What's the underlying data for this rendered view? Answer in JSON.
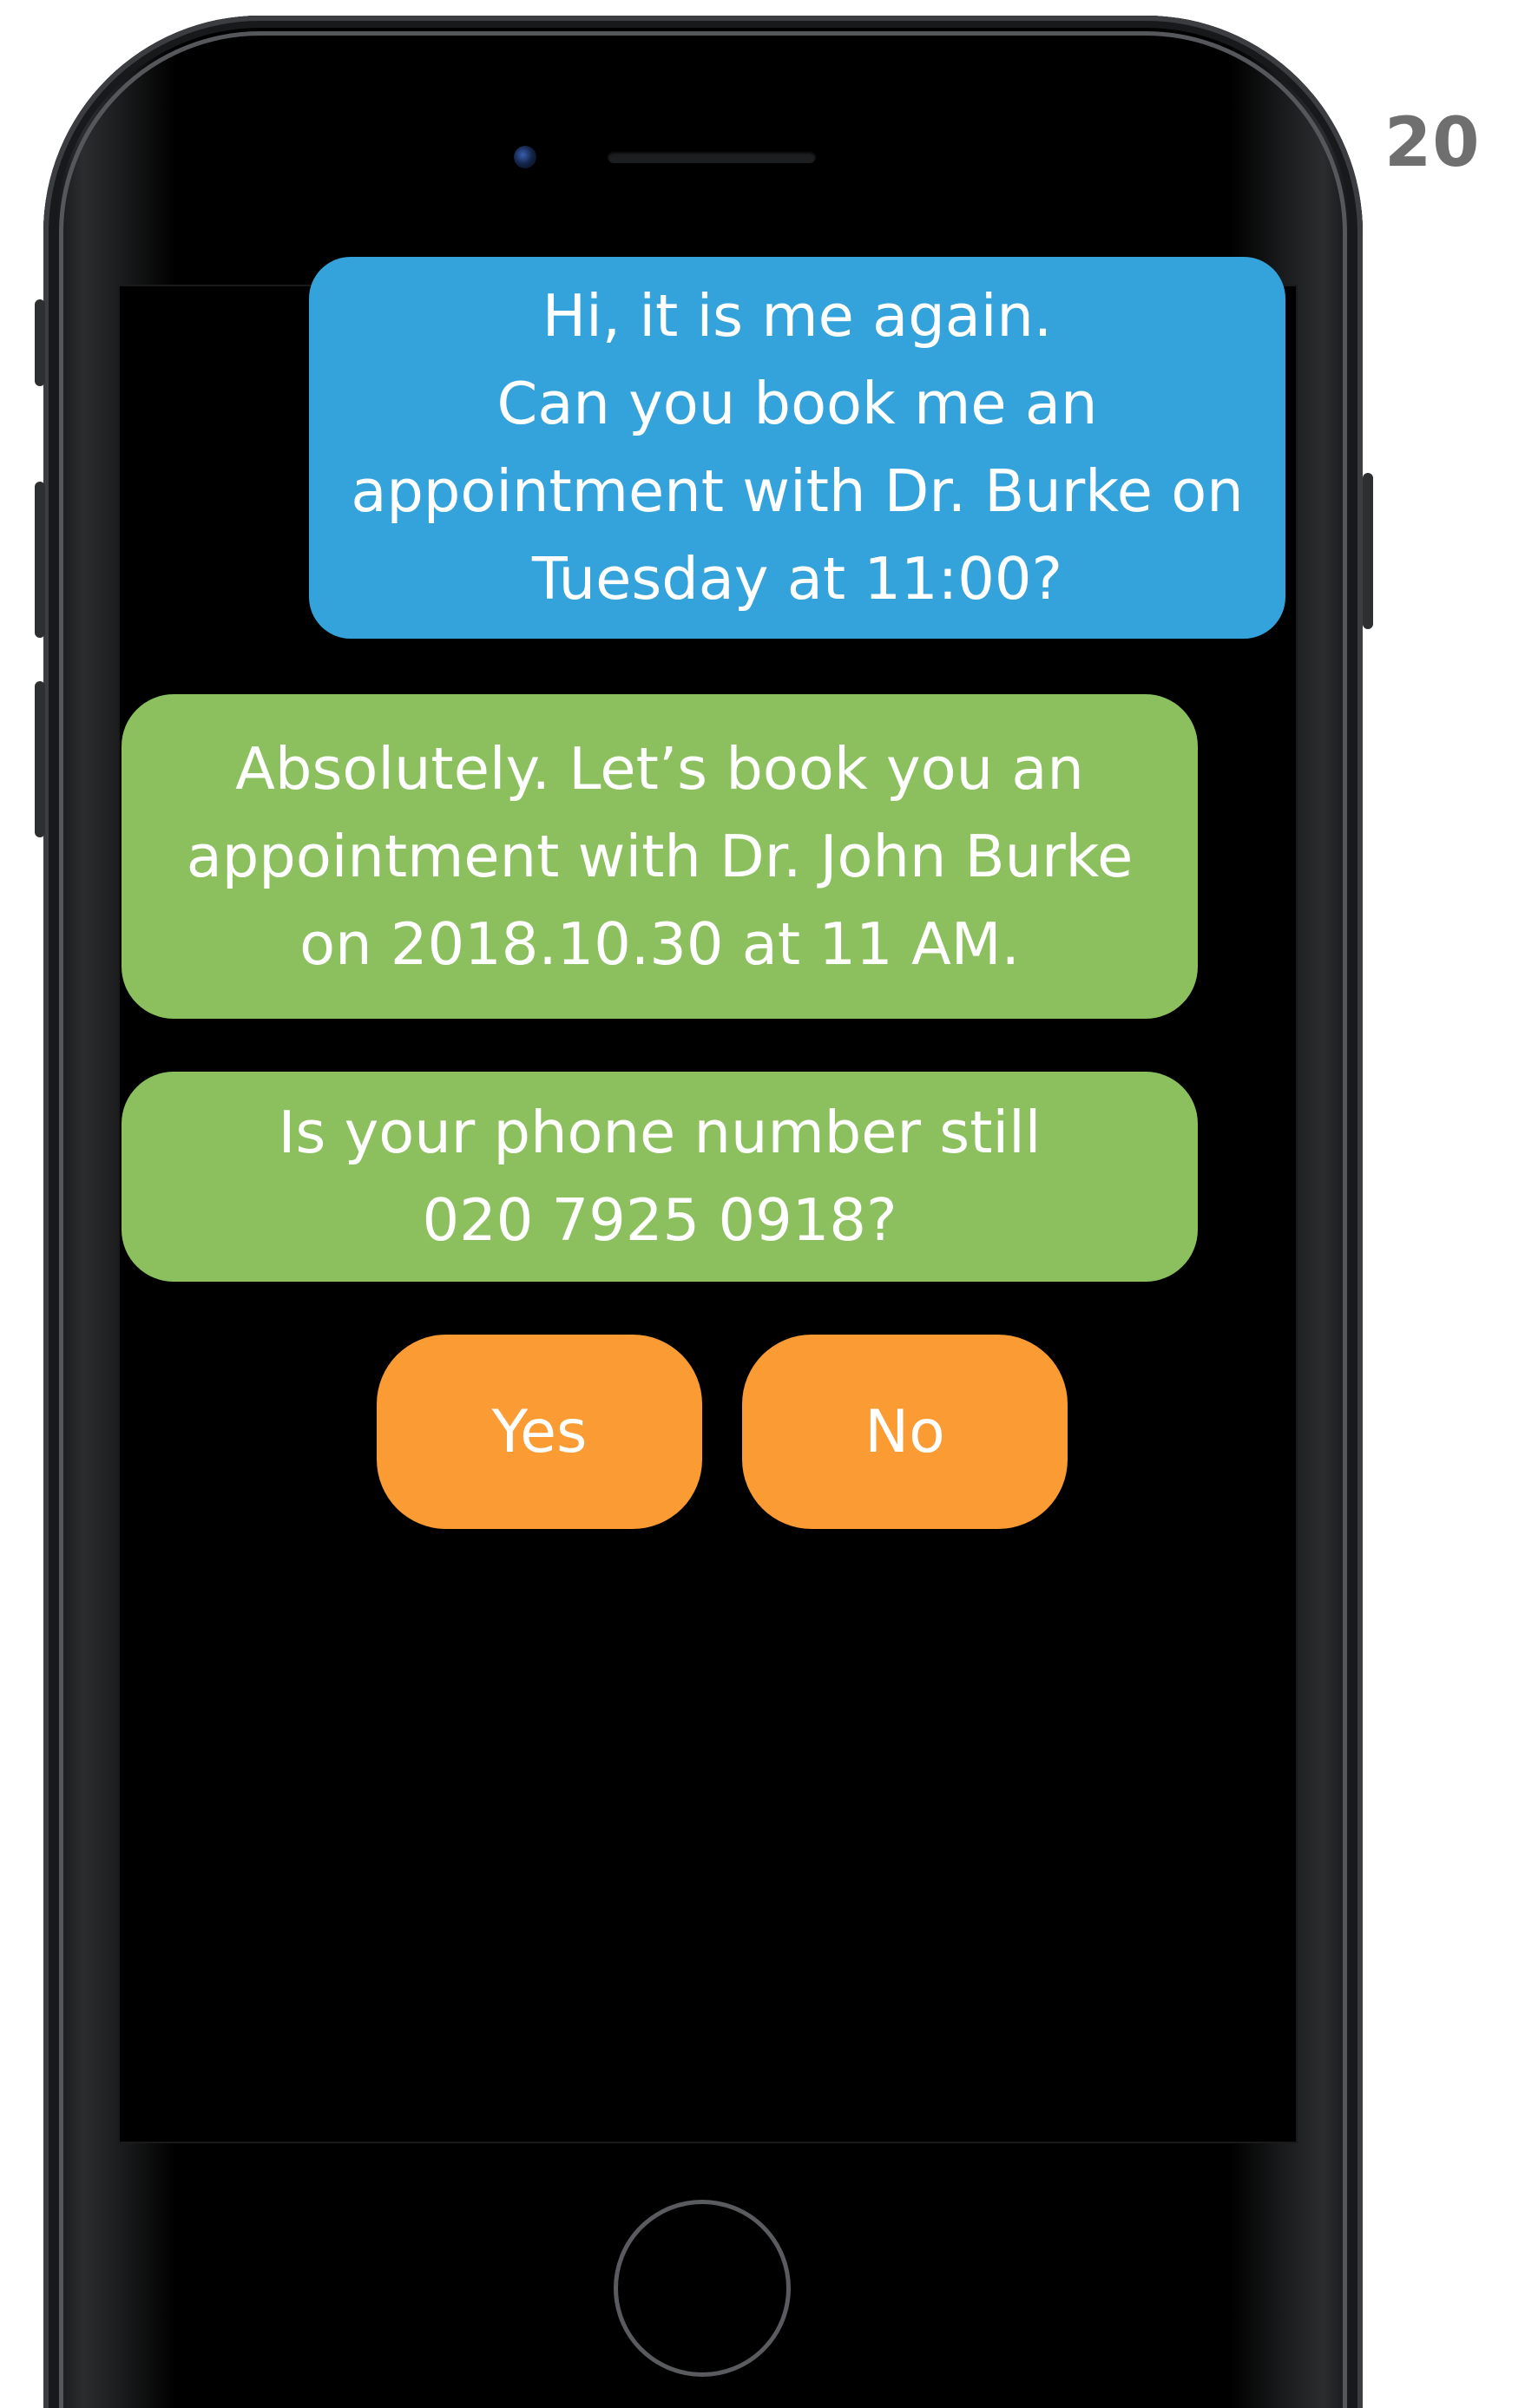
{
  "page": {
    "number": "20"
  },
  "chat": {
    "user_message": {
      "lines": [
        "Hi, it is me again.",
        "Can you book me an",
        "appointment with Dr. Burke on",
        "Tuesday at 11:00?"
      ]
    },
    "bot_messages": [
      {
        "lines": [
          "Absolutely. Let’s book you an",
          "appointment with Dr. John Burke",
          "on 2018.10.30 at 11 AM."
        ]
      },
      {
        "lines": [
          "Is your phone number still",
          "020 7925 0918?"
        ]
      }
    ],
    "quick_replies": {
      "yes_label": "Yes",
      "no_label": "No"
    }
  },
  "colors": {
    "user_bubble": "#34a2db",
    "bot_bubble": "#8cbf5e",
    "reply_button": "#fb9b34",
    "screen": "#000000",
    "page_number": "#6f6f6f"
  },
  "icons": {
    "camera": "front-camera-icon",
    "speaker": "earpiece-speaker-icon",
    "home": "home-button-icon"
  }
}
